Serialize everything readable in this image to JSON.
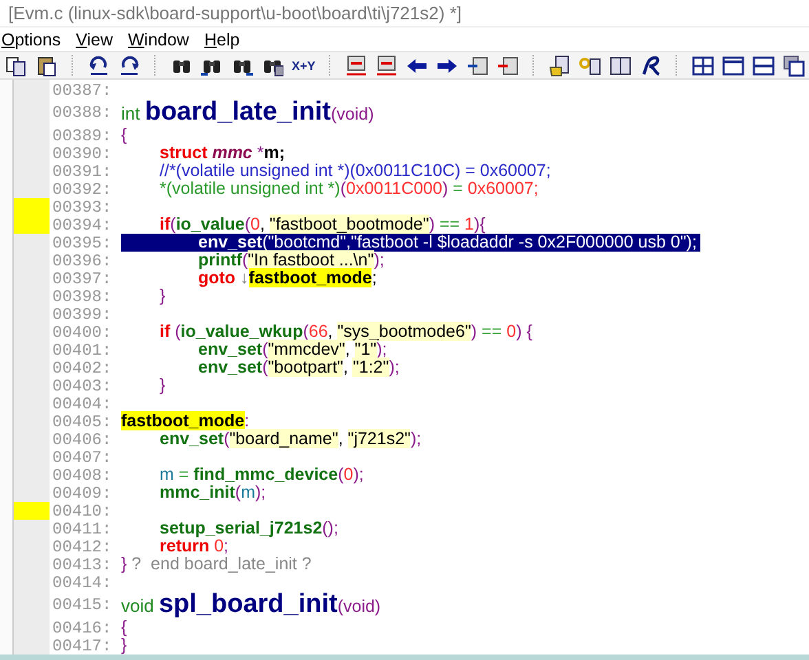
{
  "window": {
    "title": "[Evm.c (linux-sdk\\board-support\\u-boot\\board\\ti\\j721s2) *]"
  },
  "menu": [
    "Options",
    "View",
    "Window",
    "Help"
  ],
  "toolbar": {
    "replace_label": "X+Y"
  },
  "lines": [
    {
      "number": "00387:",
      "selected": false,
      "bookmarked": false
    },
    {
      "number": "00388:",
      "selected": false,
      "bookmarked": false,
      "tokens": [
        {
          "kind": "type",
          "text": "int "
        },
        {
          "kind": "fdef",
          "text": "board_late_init"
        },
        {
          "kind": "paren",
          "text": "(void)"
        }
      ]
    },
    {
      "number": "00389:",
      "selected": false,
      "bookmarked": false,
      "tokens": [
        {
          "kind": "paren",
          "text": "{"
        }
      ]
    },
    {
      "number": "00390:",
      "selected": false,
      "bookmarked": false,
      "tokens": [
        {
          "kind": "kw",
          "text": "\tstruct "
        },
        {
          "kind": "tname",
          "text": "mmc "
        },
        {
          "kind": "paren",
          "text": "*"
        },
        {
          "kind": "bold",
          "text": "m;"
        }
      ]
    },
    {
      "number": "00391:",
      "selected": false,
      "bookmarked": false,
      "tokens": [
        {
          "kind": "comment",
          "text": "\t//*(volatile unsigned int *)(0x0011C10C) = 0x60007;"
        }
      ]
    },
    {
      "number": "00392:",
      "selected": false,
      "bookmarked": false,
      "tokens": [
        {
          "kind": "cast",
          "text": "\t*(volatile unsigned int *)"
        },
        {
          "kind": "paren",
          "text": "("
        },
        {
          "kind": "num",
          "text": "0x0011C000"
        },
        {
          "kind": "paren",
          "text": ")"
        },
        {
          "kind": "op",
          "text": " = "
        },
        {
          "kind": "num",
          "text": "0x60007;"
        }
      ]
    },
    {
      "number": "00393:",
      "selected": false,
      "bookmarked": true
    },
    {
      "number": "00394:",
      "selected": false,
      "bookmarked": true,
      "tokens": [
        {
          "kind": "kw",
          "text": "\tif"
        },
        {
          "kind": "paren",
          "text": "("
        },
        {
          "kind": "call",
          "text": "io_value"
        },
        {
          "kind": "paren",
          "text": "("
        },
        {
          "kind": "num",
          "text": "0"
        },
        {
          "kind": "plain",
          "text": ", "
        },
        {
          "kind": "str",
          "text": "\"fastboot_bootmode\""
        },
        {
          "kind": "paren",
          "text": ")"
        },
        {
          "kind": "op",
          "text": " == "
        },
        {
          "kind": "num",
          "text": "1"
        },
        {
          "kind": "paren",
          "text": "){"
        }
      ]
    },
    {
      "number": "00395:",
      "selected": true,
      "bookmarked": false,
      "tokens": [
        {
          "kind": "call",
          "text": "\t\tenv_set"
        },
        {
          "kind": "paren",
          "text": "("
        },
        {
          "kind": "str",
          "text": "\"bootcmd\",\"fastboot -l $loadaddr -s 0x2F000000 usb 0\""
        },
        {
          "kind": "paren",
          "text": ");"
        }
      ]
    },
    {
      "number": "00396:",
      "selected": false,
      "bookmarked": false,
      "tokens": [
        {
          "kind": "call",
          "text": "\t\tprintf"
        },
        {
          "kind": "paren",
          "text": "("
        },
        {
          "kind": "str",
          "text": "\"In fastboot ...\\n\""
        },
        {
          "kind": "paren",
          "text": ");"
        }
      ]
    },
    {
      "number": "00397:",
      "selected": false,
      "bookmarked": false,
      "tokens": [
        {
          "kind": "kw",
          "text": "\t\tgoto "
        },
        {
          "kind": "note",
          "text": "↓"
        },
        {
          "kind": "label",
          "text": "fastboot_mode"
        },
        {
          "kind": "plain",
          "text": ";"
        }
      ]
    },
    {
      "number": "00398:",
      "selected": false,
      "bookmarked": false,
      "tokens": [
        {
          "kind": "paren",
          "text": "\t}"
        }
      ]
    },
    {
      "number": "00399:",
      "selected": false,
      "bookmarked": false
    },
    {
      "number": "00400:",
      "selected": false,
      "bookmarked": false,
      "tokens": [
        {
          "kind": "kw",
          "text": "\tif "
        },
        {
          "kind": "paren",
          "text": "("
        },
        {
          "kind": "call",
          "text": "io_value_wkup"
        },
        {
          "kind": "paren",
          "text": "("
        },
        {
          "kind": "num",
          "text": "66"
        },
        {
          "kind": "plain",
          "text": ", "
        },
        {
          "kind": "str",
          "text": "\"sys_bootmode6\""
        },
        {
          "kind": "paren",
          "text": ")"
        },
        {
          "kind": "op",
          "text": " == "
        },
        {
          "kind": "num",
          "text": "0"
        },
        {
          "kind": "paren",
          "text": ") {"
        }
      ]
    },
    {
      "number": "00401:",
      "selected": false,
      "bookmarked": false,
      "tokens": [
        {
          "kind": "call",
          "text": "\t\tenv_set"
        },
        {
          "kind": "paren",
          "text": "("
        },
        {
          "kind": "str",
          "text": "\"mmcdev\""
        },
        {
          "kind": "plain",
          "text": ", "
        },
        {
          "kind": "str",
          "text": "\"1\""
        },
        {
          "kind": "paren",
          "text": ");"
        }
      ]
    },
    {
      "number": "00402:",
      "selected": false,
      "bookmarked": false,
      "tokens": [
        {
          "kind": "call",
          "text": "\t\tenv_set"
        },
        {
          "kind": "paren",
          "text": "("
        },
        {
          "kind": "str",
          "text": "\"bootpart\""
        },
        {
          "kind": "plain",
          "text": ", "
        },
        {
          "kind": "str",
          "text": "\"1:2\""
        },
        {
          "kind": "paren",
          "text": ");"
        }
      ]
    },
    {
      "number": "00403:",
      "selected": false,
      "bookmarked": false,
      "tokens": [
        {
          "kind": "paren",
          "text": "\t}"
        }
      ]
    },
    {
      "number": "00404:",
      "selected": false,
      "bookmarked": false
    },
    {
      "number": "00405:",
      "selected": false,
      "bookmarked": false,
      "tokens": [
        {
          "kind": "label",
          "text": "fastboot_mode"
        },
        {
          "kind": "paren",
          "text": ":"
        }
      ]
    },
    {
      "number": "00406:",
      "selected": false,
      "bookmarked": false,
      "tokens": [
        {
          "kind": "call",
          "text": "\tenv_set"
        },
        {
          "kind": "paren",
          "text": "("
        },
        {
          "kind": "str",
          "text": "\"board_name\""
        },
        {
          "kind": "plain",
          "text": ", "
        },
        {
          "kind": "str",
          "text": "\"j721s2\""
        },
        {
          "kind": "paren",
          "text": ");"
        }
      ]
    },
    {
      "number": "00407:",
      "selected": false,
      "bookmarked": false
    },
    {
      "number": "00408:",
      "selected": false,
      "bookmarked": false,
      "tokens": [
        {
          "kind": "local",
          "text": "\tm "
        },
        {
          "kind": "op",
          "text": "= "
        },
        {
          "kind": "call",
          "text": "find_mmc_device"
        },
        {
          "kind": "paren",
          "text": "("
        },
        {
          "kind": "num",
          "text": "0"
        },
        {
          "kind": "paren",
          "text": ");"
        }
      ]
    },
    {
      "number": "00409:",
      "selected": false,
      "bookmarked": false,
      "tokens": [
        {
          "kind": "call",
          "text": "\tmmc_init"
        },
        {
          "kind": "paren",
          "text": "("
        },
        {
          "kind": "local",
          "text": "m"
        },
        {
          "kind": "paren",
          "text": ");"
        }
      ]
    },
    {
      "number": "00410:",
      "selected": false,
      "bookmarked": true
    },
    {
      "number": "00411:",
      "selected": false,
      "bookmarked": false,
      "tokens": [
        {
          "kind": "call",
          "text": "\tsetup_serial_j721s2"
        },
        {
          "kind": "paren",
          "text": "();"
        }
      ]
    },
    {
      "number": "00412:",
      "selected": false,
      "bookmarked": false,
      "tokens": [
        {
          "kind": "kw",
          "text": "\treturn "
        },
        {
          "kind": "num",
          "text": "0"
        },
        {
          "kind": "paren",
          "text": ";"
        }
      ]
    },
    {
      "number": "00413:",
      "selected": false,
      "bookmarked": false,
      "tokens": [
        {
          "kind": "paren",
          "text": "}"
        },
        {
          "kind": "note",
          "text": " ?  end board_late_init ?"
        }
      ]
    },
    {
      "number": "00414:",
      "selected": false,
      "bookmarked": false
    },
    {
      "number": "00415:",
      "selected": false,
      "bookmarked": false,
      "tokens": [
        {
          "kind": "type",
          "text": "void "
        },
        {
          "kind": "fdef",
          "text": "spl_board_init"
        },
        {
          "kind": "paren",
          "text": "(void)"
        }
      ]
    },
    {
      "number": "00416:",
      "selected": false,
      "bookmarked": false,
      "tokens": [
        {
          "kind": "paren",
          "text": "{"
        }
      ]
    },
    {
      "number": "00417:",
      "selected": false,
      "bookmarked": false,
      "tokens": [
        {
          "kind": "paren",
          "text": "}"
        }
      ]
    }
  ]
}
